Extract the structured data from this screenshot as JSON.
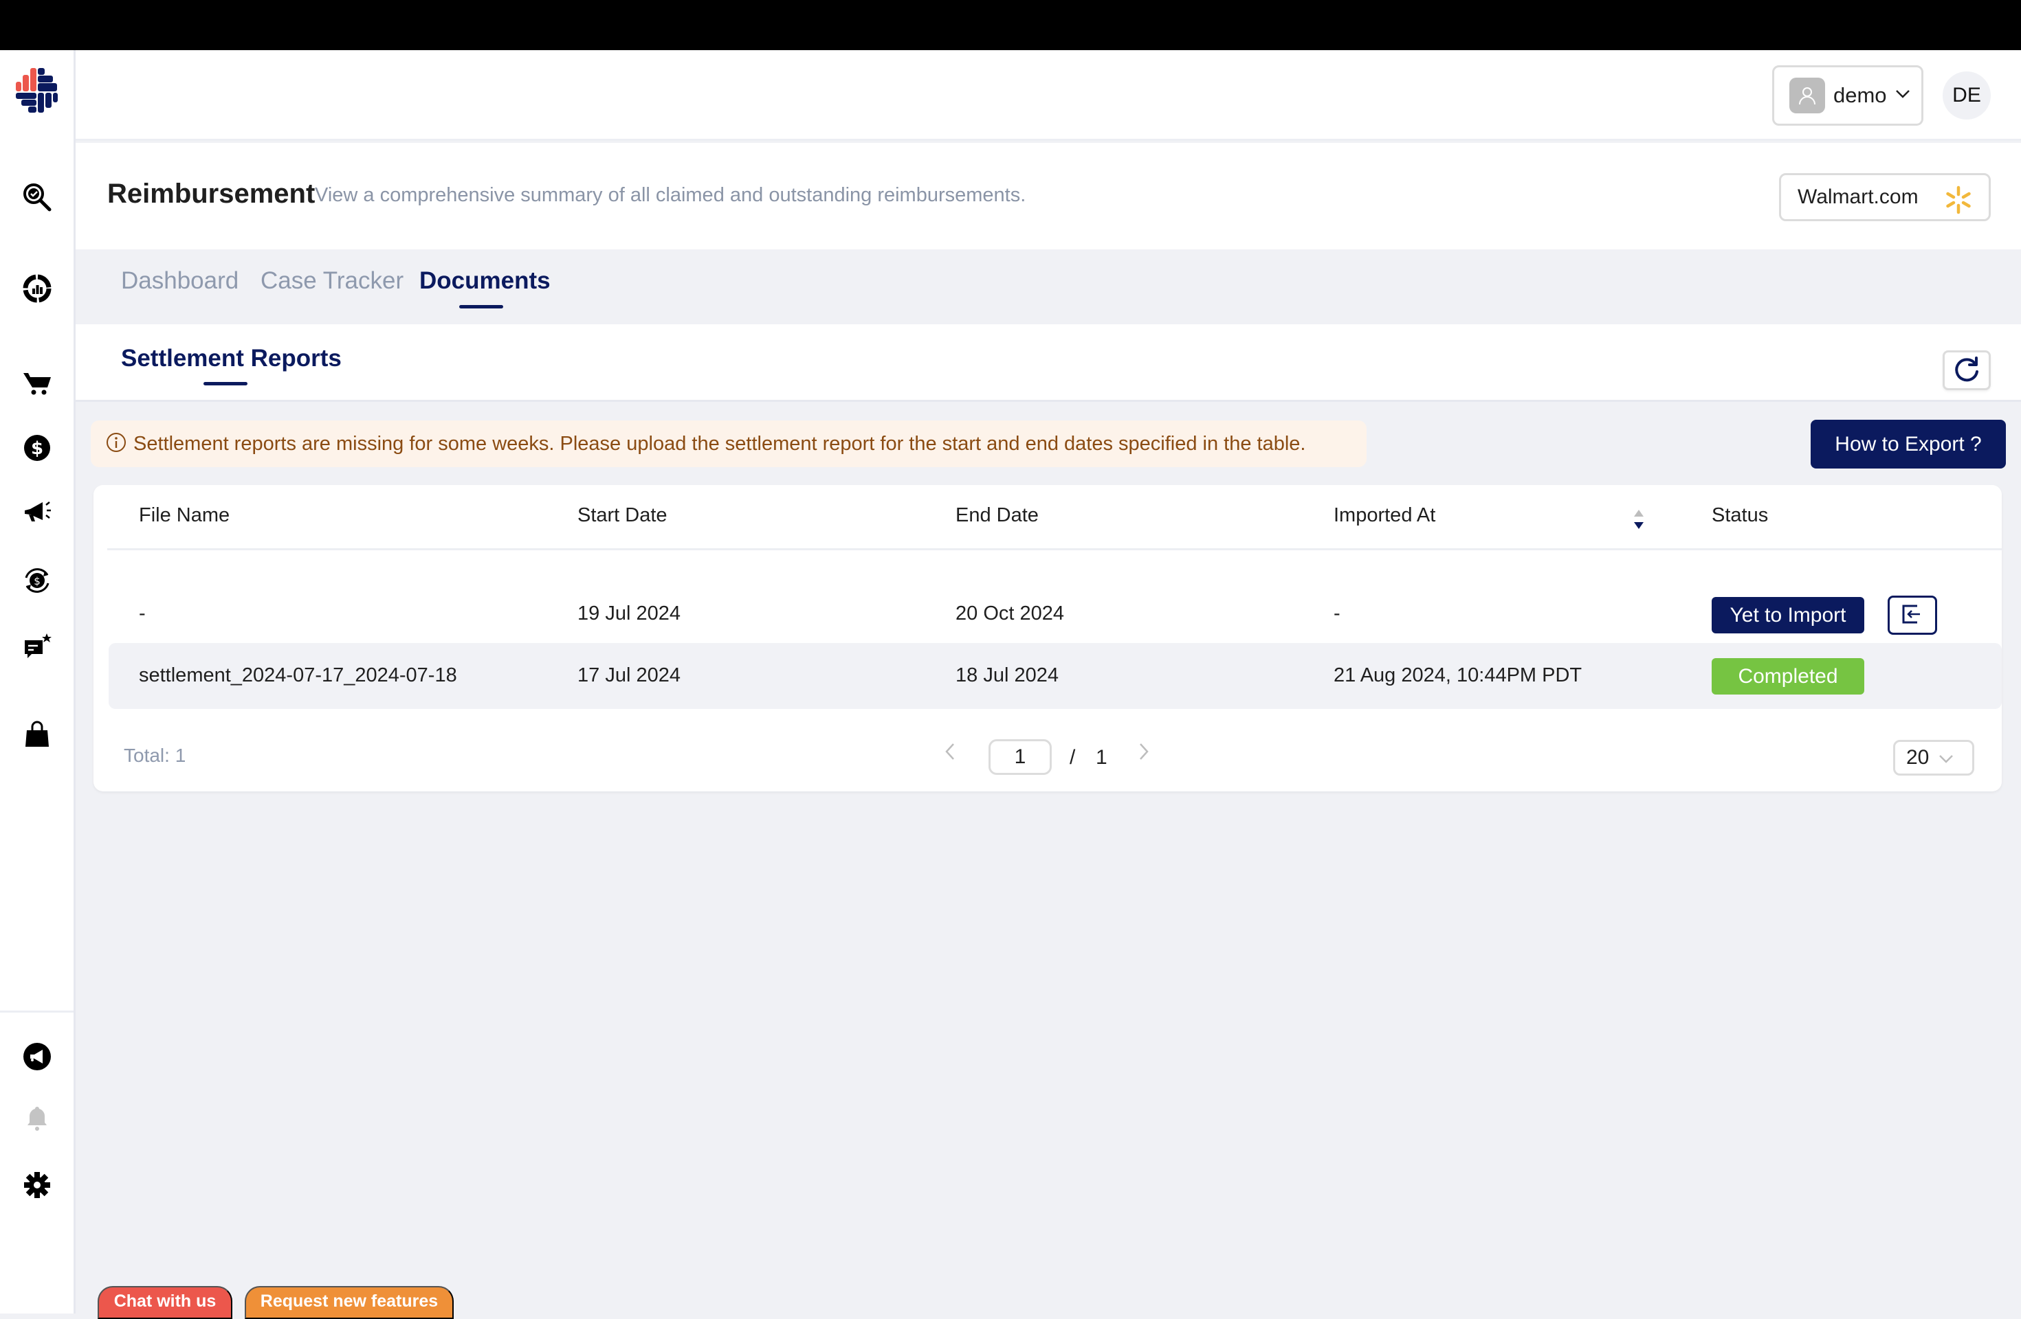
{
  "sidebar": {
    "logo": "app-logo",
    "items": [
      {
        "name": "audit-search",
        "icon": "search-check-icon"
      },
      {
        "name": "analytics",
        "icon": "chart-donut-icon"
      },
      {
        "name": "orders",
        "icon": "cart-icon"
      },
      {
        "name": "reimbursement",
        "icon": "dollar-circle-icon"
      },
      {
        "name": "advertising",
        "icon": "megaphone-icon"
      },
      {
        "name": "refunds",
        "icon": "dollar-refresh-icon"
      },
      {
        "name": "reviews",
        "icon": "chat-star-icon"
      },
      {
        "name": "products",
        "icon": "shopping-bag-icon"
      }
    ],
    "bottom_items": [
      {
        "name": "announcements",
        "icon": "announcement-icon"
      },
      {
        "name": "notifications",
        "icon": "bell-icon"
      },
      {
        "name": "settings",
        "icon": "gear-icon"
      }
    ]
  },
  "header": {
    "user_label": "demo",
    "user_initials": "DE"
  },
  "page": {
    "title": "Reimbursement",
    "subtitle": "View a comprehensive summary of all claimed and outstanding reimbursements.",
    "store": "Walmart.com",
    "store_logo_color": "#f2b83b"
  },
  "tabs": [
    {
      "label": "Dashboard",
      "active": false
    },
    {
      "label": "Case Tracker",
      "active": false
    },
    {
      "label": "Documents",
      "active": true
    }
  ],
  "subtabs": [
    {
      "label": "Settlement Reports",
      "active": true
    }
  ],
  "alert": {
    "text": "Settlement reports are missing for some weeks. Please upload the settlement report for the start and end dates specified in the table."
  },
  "export_button": "How to Export ?",
  "table": {
    "columns": [
      "File Name",
      "Start Date",
      "End Date",
      "Imported At",
      "Status"
    ],
    "rows": [
      {
        "file_name": "-",
        "start_date": "19 Jul 2024",
        "end_date": "20 Oct 2024",
        "imported_at": "-",
        "status": "Yet to Import",
        "status_color": "#0b1a5e",
        "has_import_action": true
      },
      {
        "file_name": "settlement_2024-07-17_2024-07-18",
        "start_date": "17 Jul 2024",
        "end_date": "18 Jul 2024",
        "imported_at": "21 Aug 2024, 10:44PM PDT",
        "status": "Completed",
        "status_color": "#76c442",
        "has_import_action": false
      }
    ]
  },
  "pagination": {
    "total_label": "Total: 1",
    "current_page": "1",
    "separator": "/",
    "total_pages": "1",
    "page_size": "20"
  },
  "footer_buttons": {
    "chat": "Chat with us",
    "request": "Request new features"
  },
  "colors": {
    "brand_navy": "#0b1a5e",
    "brand_red": "#ec574c",
    "success": "#76c442",
    "warning_bg": "#fdf3ea",
    "warning_text": "#8a4b12"
  }
}
